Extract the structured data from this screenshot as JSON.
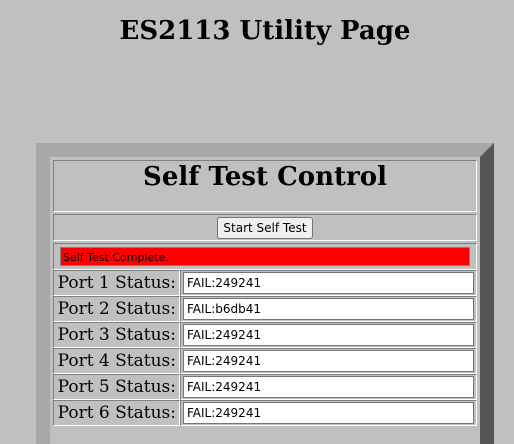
{
  "page": {
    "title": "ES2113 Utility Page"
  },
  "self_test": {
    "section_title": "Self Test Control",
    "start_button_label": "Start Self Test",
    "status_message": "Self Test Complete.",
    "status_color": "#ff0000",
    "ports": [
      {
        "label": "Port 1 Status:",
        "value": "FAIL:249241"
      },
      {
        "label": "Port 2 Status:",
        "value": "FAIL:b6db41"
      },
      {
        "label": "Port 3 Status:",
        "value": "FAIL:249241"
      },
      {
        "label": "Port 4 Status:",
        "value": "FAIL:249241"
      },
      {
        "label": "Port 5 Status:",
        "value": "FAIL:249241"
      },
      {
        "label": "Port 6 Status:",
        "value": "FAIL:249241"
      }
    ]
  }
}
